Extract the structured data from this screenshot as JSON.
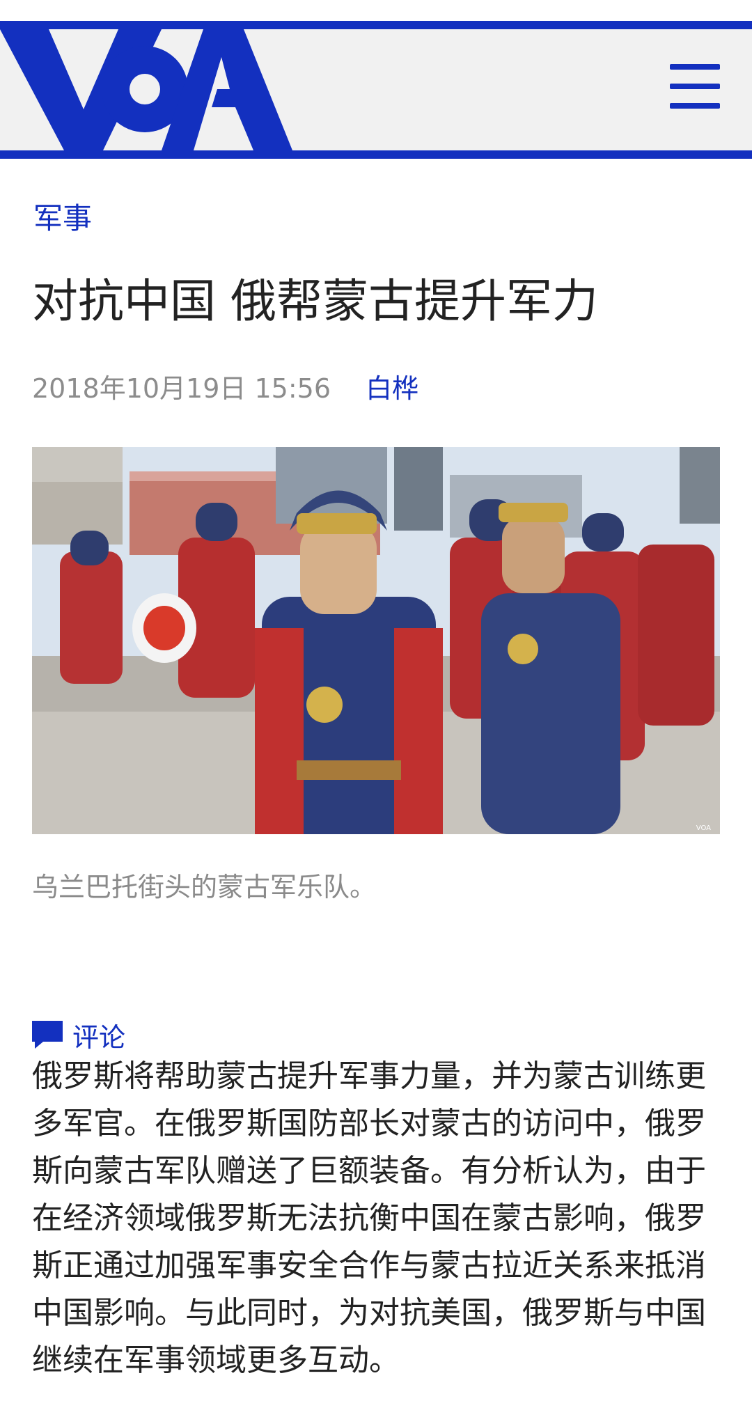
{
  "header": {
    "logo_text": "VOA",
    "brand_color": "#1330bf",
    "menu_icon": "hamburger-menu-icon"
  },
  "article": {
    "category": "军事",
    "title": "对抗中国 俄帮蒙古提升军力",
    "date": "2018年10月19日 15:56",
    "author": "白桦",
    "image_watermark": "VOA",
    "image_caption": "乌兰巴托街头的蒙古军乐队。",
    "comments_label": "评论",
    "comments_icon": "comment-bubble-icon",
    "body": "俄罗斯将帮助蒙古提升军事力量，并为蒙古训练更多军官。在俄罗斯国防部长对蒙古的访问中，俄罗斯向蒙古军队赠送了巨额装备。有分析认为，由于在经济领域俄罗斯无法抗衡中国在蒙古影响，俄罗斯正通过加强军事安全合作与蒙古拉近关系来抵消中国影响。与此同时，为对抗美国，俄罗斯与中国继续在军事领域更多互动。"
  }
}
